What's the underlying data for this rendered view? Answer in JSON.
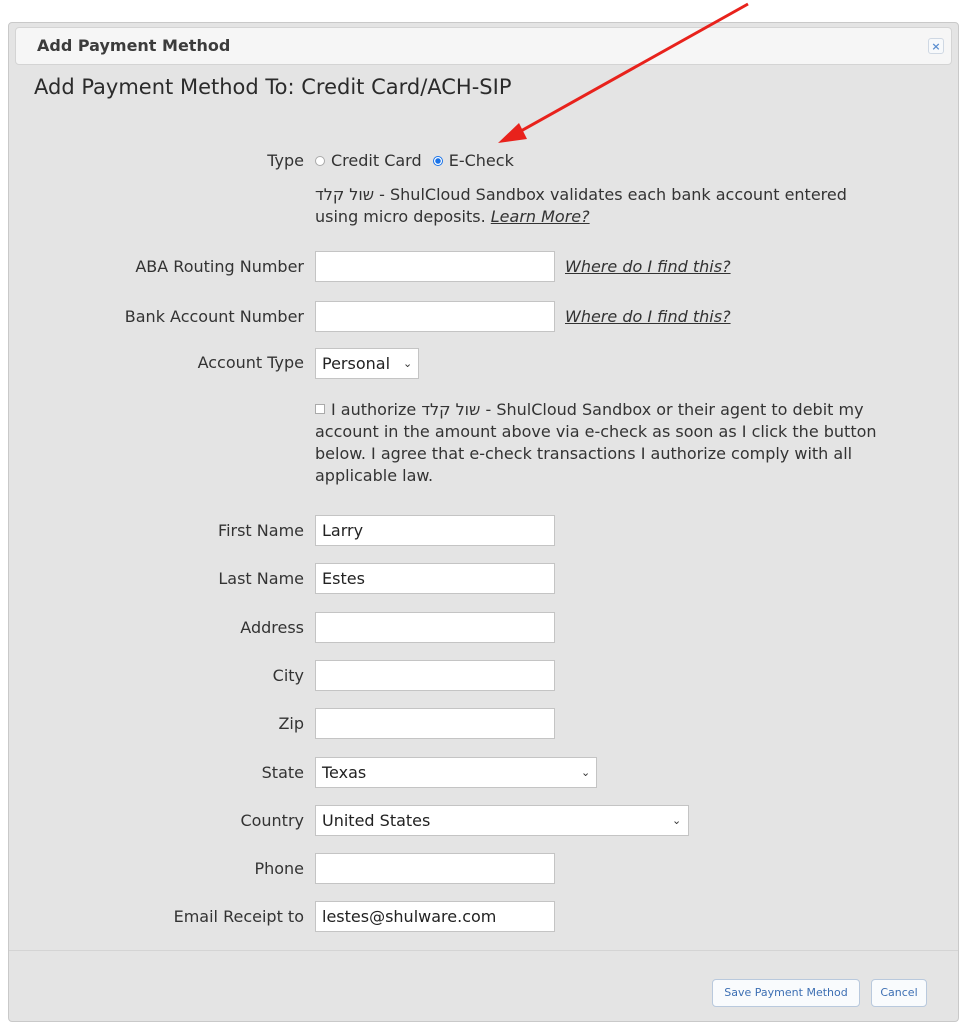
{
  "dialog": {
    "title": "Add Payment Method",
    "close_icon": "×",
    "heading": "Add Payment Method To: Credit Card/ACH-SIP"
  },
  "type_row": {
    "label": "Type",
    "options": [
      "Credit Card",
      "E-Check"
    ],
    "selected": "E-Check"
  },
  "info": {
    "text": "שול קלד - ShulCloud Sandbox validates each bank account entered using micro deposits.",
    "link": "Learn More?"
  },
  "routing": {
    "label": "ABA Routing Number",
    "value": "",
    "help": "Where do I find this?"
  },
  "account": {
    "label": "Bank Account Number",
    "value": "",
    "help": "Where do I find this?"
  },
  "account_type": {
    "label": "Account Type",
    "value": "Personal"
  },
  "authorize": {
    "text": "I authorize שול קלד - ShulCloud Sandbox or their agent to debit my account in the amount above via e-check as soon as I click the button below. I agree that e-check transactions I authorize comply with all applicable law."
  },
  "fields": {
    "first_name": {
      "label": "First Name",
      "value": "Larry"
    },
    "last_name": {
      "label": "Last Name",
      "value": "Estes"
    },
    "address": {
      "label": "Address",
      "value": ""
    },
    "city": {
      "label": "City",
      "value": ""
    },
    "zip": {
      "label": "Zip",
      "value": ""
    },
    "state": {
      "label": "State",
      "value": "Texas"
    },
    "country": {
      "label": "Country",
      "value": "United States"
    },
    "phone": {
      "label": "Phone",
      "value": ""
    },
    "email": {
      "label": "Email Receipt to",
      "value": "lestes@shulware.com"
    }
  },
  "buttons": {
    "save": "Save Payment Method",
    "cancel": "Cancel"
  },
  "colors": {
    "annotation_arrow": "#e8221c",
    "link_blue": "#3d6fb3"
  }
}
